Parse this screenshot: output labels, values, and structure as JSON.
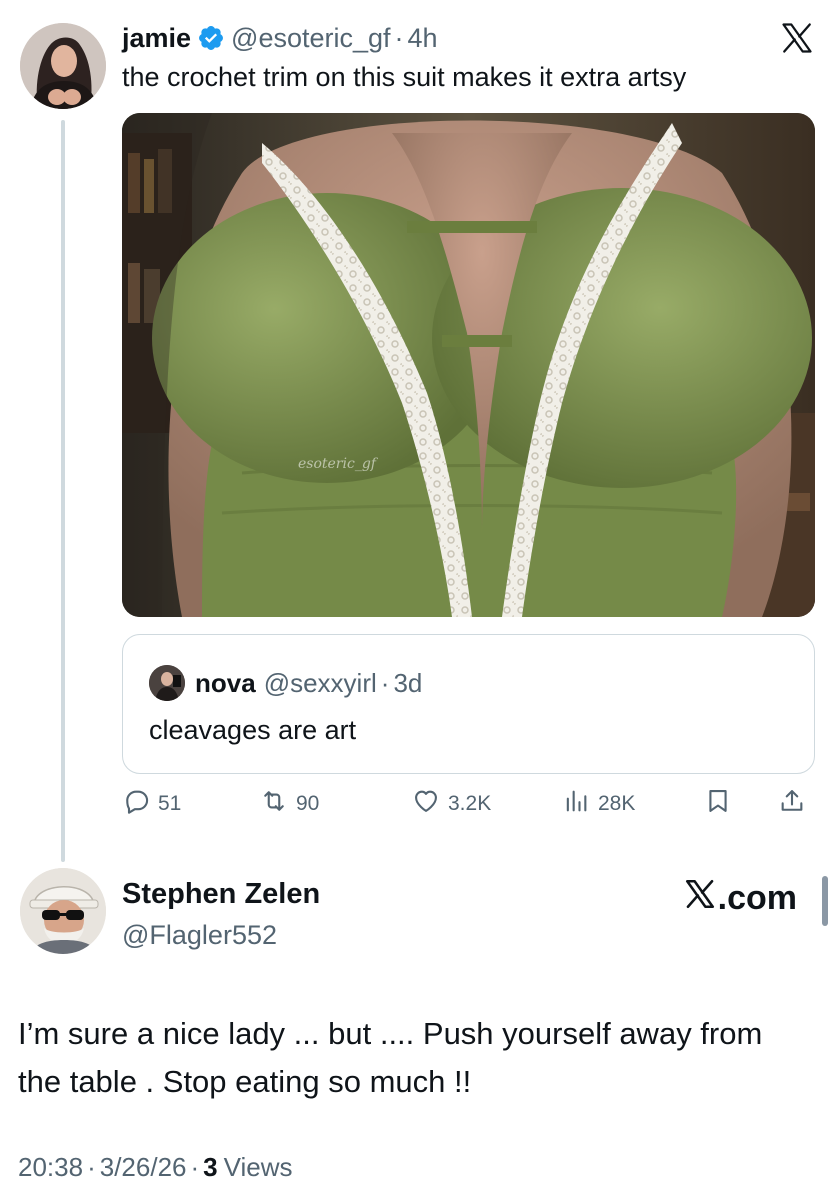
{
  "quoted_post": {
    "author_name": "jamie",
    "author_handle": "@esoteric_gf",
    "separator": "·",
    "time_ago": "4h",
    "text": "the crochet trim on this suit makes it extra artsy",
    "media_watermark": "esoteric_gf",
    "quote": {
      "author_name": "nova",
      "author_handle": "@sexxyirl",
      "separator": "·",
      "time_ago": "3d",
      "text": "cleavages are art"
    },
    "actions": {
      "replies": "51",
      "reposts": "90",
      "likes": "3.2K",
      "views": "28K"
    }
  },
  "reply_post": {
    "author_name": "Stephen Zelen",
    "author_handle": "@Flagler552",
    "brand_label": ".com",
    "text": "I’m sure a nice lady ... but .... Push yourself away from the table . Stop eating so much !!",
    "time": "20:38",
    "separator": "·",
    "date": "3/26/26",
    "views_count": "3",
    "views_label": "Views"
  },
  "icons": [
    "verified-badge-icon",
    "x-logo-icon",
    "reply-icon",
    "repost-icon",
    "like-icon",
    "views-icon",
    "bookmark-icon",
    "share-icon"
  ],
  "colors": {
    "text": "#0f1419",
    "secondary_text": "#536471",
    "verified": "#1d9bf0",
    "border": "#cfd9de",
    "dress_green": "#7f9152"
  }
}
